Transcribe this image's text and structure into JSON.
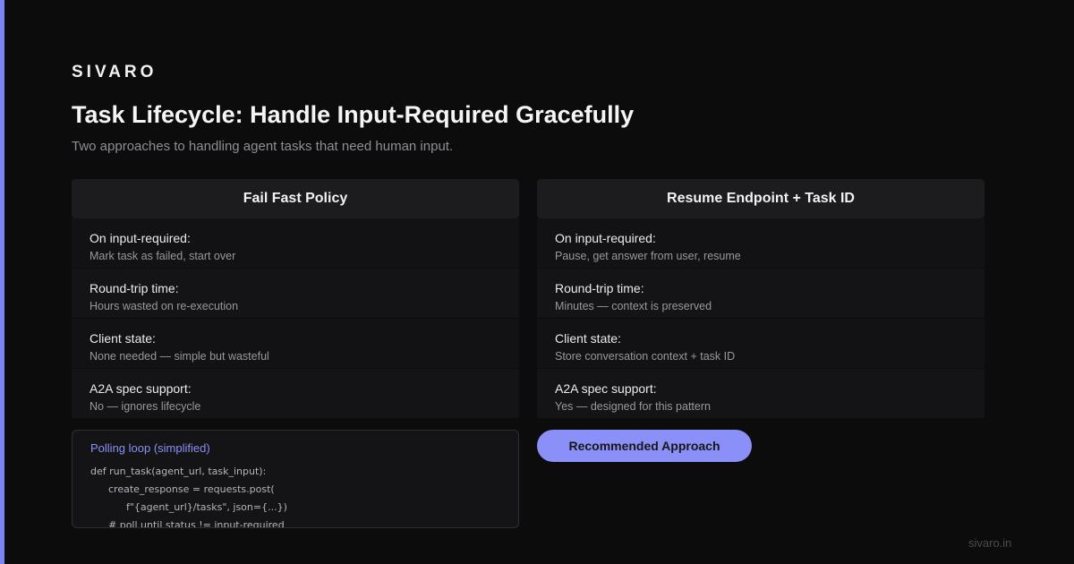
{
  "brand": "SIVARO",
  "title": "Task Lifecycle: Handle Input-Required Gracefully",
  "subtitle": "Two approaches to handling agent tasks that need human input.",
  "columns": [
    {
      "header": "Fail Fast Policy",
      "rows": [
        {
          "label": "On input-required:",
          "value": "Mark task as failed, start over"
        },
        {
          "label": "Round-trip time:",
          "value": "Hours wasted on re-execution"
        },
        {
          "label": "Client state:",
          "value": "None needed — simple but wasteful"
        },
        {
          "label": "A2A spec support:",
          "value": "No — ignores lifecycle"
        }
      ]
    },
    {
      "header": "Resume Endpoint + Task ID",
      "rows": [
        {
          "label": "On input-required:",
          "value": "Pause, get answer from user, resume"
        },
        {
          "label": "Round-trip time:",
          "value": "Minutes — context is preserved"
        },
        {
          "label": "Client state:",
          "value": "Store conversation context + task ID"
        },
        {
          "label": "A2A spec support:",
          "value": "Yes — designed for this pattern"
        }
      ]
    }
  ],
  "code": {
    "title": "Polling loop (simplified)",
    "lines": [
      "def run_task(agent_url, task_input):",
      "create_response = requests.post(",
      "f\"{agent_url}/tasks\", json={...})",
      "# poll until status != input-required"
    ]
  },
  "recommend_button": "Recommended Approach",
  "footer": "sivaro.in",
  "colors": {
    "accent": "#7b83f3",
    "button": "#8a90f7",
    "background": "#0c0c0d"
  }
}
